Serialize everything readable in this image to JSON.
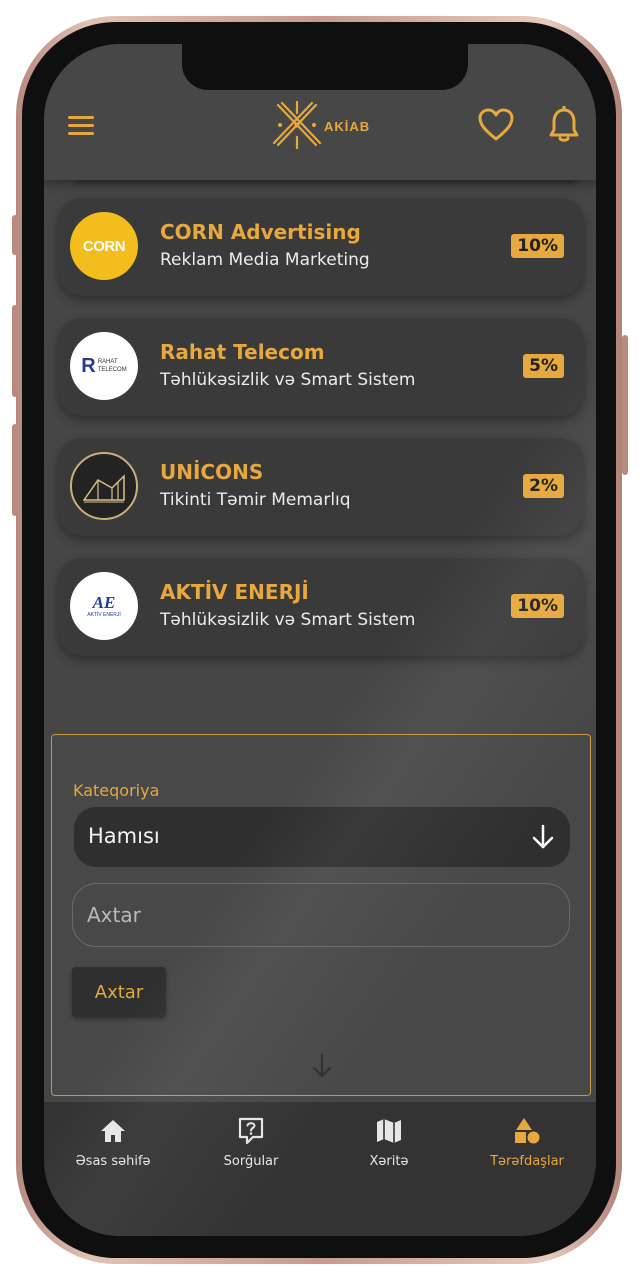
{
  "app": {
    "logo_text": "AKİAB"
  },
  "header": {
    "menu_icon": "hamburger-menu-icon",
    "favorites_icon": "heart-icon",
    "notifications_icon": "bell-icon"
  },
  "partners": [
    {
      "name": "CORN Advertising",
      "category": "Reklam Media Marketing",
      "discount": "10%",
      "logo_text": "CORN"
    },
    {
      "name": "Rahat Telecom",
      "category": "Təhlükəsizlik və Smart Sistem",
      "discount": "5%",
      "logo_text_1": "RAHAT",
      "logo_text_2": "TELECOM"
    },
    {
      "name": "UNİCONS",
      "category": "Tikinti Təmir Memarlıq",
      "discount": "2%"
    },
    {
      "name": "AKTİV ENERJİ",
      "category": "Təhlükəsizlik və Smart Sistem",
      "discount": "10%",
      "logo_mark": "AE",
      "logo_text": "AKTİV ENERJİ"
    }
  ],
  "filter": {
    "category_label": "Kateqoriya",
    "category_value": "Hamısı",
    "search_placeholder": "Axtar",
    "search_button": "Axtar"
  },
  "nav": [
    {
      "label": "Əsas səhifə",
      "icon": "home-icon",
      "active": false
    },
    {
      "label": "Sorğular",
      "icon": "question-bubble-icon",
      "active": false
    },
    {
      "label": "Xəritə",
      "icon": "map-icon",
      "active": false
    },
    {
      "label": "Tərəfdaşlar",
      "icon": "shapes-icon",
      "active": true
    }
  ],
  "colors": {
    "accent": "#e7a83d",
    "background": "#464646",
    "card": "#3a3a3a",
    "nav_bar": "#333333",
    "frame": "#d2a99c"
  }
}
